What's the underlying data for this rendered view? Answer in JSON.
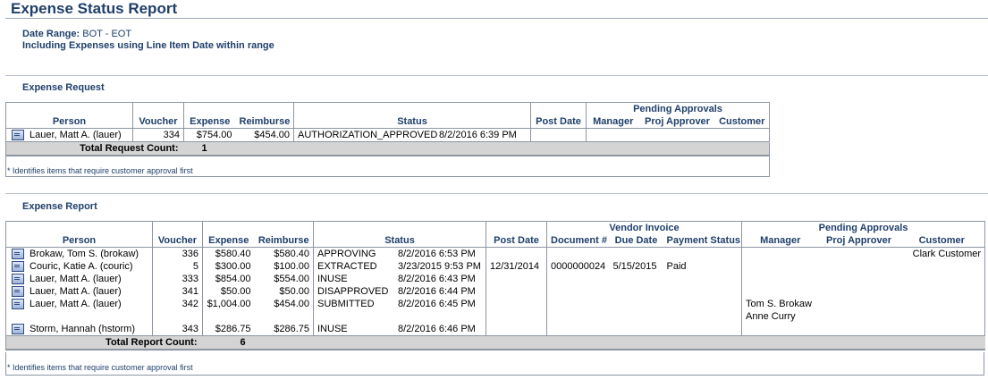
{
  "page": {
    "title": "Expense Status Report",
    "date_range_label": "Date Range:",
    "date_range_value": "BOT - EOT",
    "including_note": "Including Expenses using Line Item Date within range"
  },
  "request_section": {
    "title": "Expense Request",
    "headers": {
      "person": "Person",
      "voucher": "Voucher",
      "expense": "Expense",
      "reimburse": "Reimburse",
      "status": "Status",
      "post_date": "Post Date",
      "pending_approvals": "Pending Approvals",
      "manager": "Manager",
      "proj_approver": "Proj Approver",
      "customer": "Customer"
    },
    "rows": [
      {
        "person": "Lauer, Matt A. (lauer)",
        "voucher": "334",
        "expense": "$754.00",
        "reimburse": "$454.00",
        "status": "AUTHORIZATION_APPROVED",
        "status_date": "8/2/2016 6:39 PM",
        "post_date": "",
        "manager": "",
        "proj_approver": "",
        "customer": ""
      }
    ],
    "total_label": "Total Request Count:",
    "total_value": "1",
    "footnote": "* Identifies items that require customer approval first"
  },
  "report_section": {
    "title": "Expense Report",
    "headers": {
      "person": "Person",
      "voucher": "Voucher",
      "expense": "Expense",
      "reimburse": "Reimburse",
      "status": "Status",
      "post_date": "Post Date",
      "vendor_invoice": "Vendor Invoice",
      "document": "Document #",
      "due_date": "Due Date",
      "payment_status": "Payment Status",
      "pending_approvals": "Pending Approvals",
      "manager": "Manager",
      "proj_approver": "Proj Approver",
      "customer": "Customer"
    },
    "rows": [
      {
        "person": "Brokaw, Tom S. (brokaw)",
        "voucher": "336",
        "expense": "$580.40",
        "reimburse": "$580.40",
        "status": "APPROVING",
        "status_date": "8/2/2016 6:53 PM",
        "post_date": "",
        "document": "",
        "due_date": "",
        "payment_status": "",
        "manager": "",
        "proj_approver": "",
        "customer": "Clark Customer"
      },
      {
        "person": "Couric, Katie A. (couric)",
        "voucher": "5",
        "expense": "$300.00",
        "reimburse": "$100.00",
        "status": "EXTRACTED",
        "status_date": "3/23/2015 9:53 PM",
        "post_date": "12/31/2014",
        "document": "0000000024",
        "due_date": "5/15/2015",
        "payment_status": "Paid",
        "manager": "",
        "proj_approver": "",
        "customer": ""
      },
      {
        "person": "Lauer, Matt A. (lauer)",
        "voucher": "333",
        "expense": "$854.00",
        "reimburse": "$554.00",
        "status": "INUSE",
        "status_date": "8/2/2016 6:43 PM",
        "post_date": "",
        "document": "",
        "due_date": "",
        "payment_status": "",
        "manager": "",
        "proj_approver": "",
        "customer": ""
      },
      {
        "person": "Lauer, Matt A. (lauer)",
        "voucher": "341",
        "expense": "$50.00",
        "reimburse": "$50.00",
        "status": "DISAPPROVED",
        "status_date": "8/2/2016 6:44 PM",
        "post_date": "",
        "document": "",
        "due_date": "",
        "payment_status": "",
        "manager": "",
        "proj_approver": "",
        "customer": ""
      },
      {
        "person": "Lauer, Matt A. (lauer)",
        "voucher": "342",
        "expense": "$1,004.00",
        "reimburse": "$454.00",
        "status": "SUBMITTED",
        "status_date": "8/2/2016 6:45 PM",
        "post_date": "",
        "document": "",
        "due_date": "",
        "payment_status": "",
        "manager": "Tom S. Brokaw",
        "manager2": "Anne Curry",
        "proj_approver": "",
        "customer": ""
      },
      {
        "person": "Storm, Hannah (hstorm)",
        "voucher": "343",
        "expense": "$286.75",
        "reimburse": "$286.75",
        "status": "INUSE",
        "status_date": "8/2/2016 6:46 PM",
        "post_date": "",
        "document": "",
        "due_date": "",
        "payment_status": "",
        "manager": "",
        "proj_approver": "",
        "customer": ""
      }
    ],
    "total_label": "Total Report Count:",
    "total_value": "6",
    "footnote": "* Identifies items that require customer approval first"
  },
  "icons": {
    "row_icon": "document-detail-icon"
  },
  "colors": {
    "heading": "#1f3f6b",
    "border": "#8c96a3",
    "total_bg": "#d4d4d4"
  }
}
